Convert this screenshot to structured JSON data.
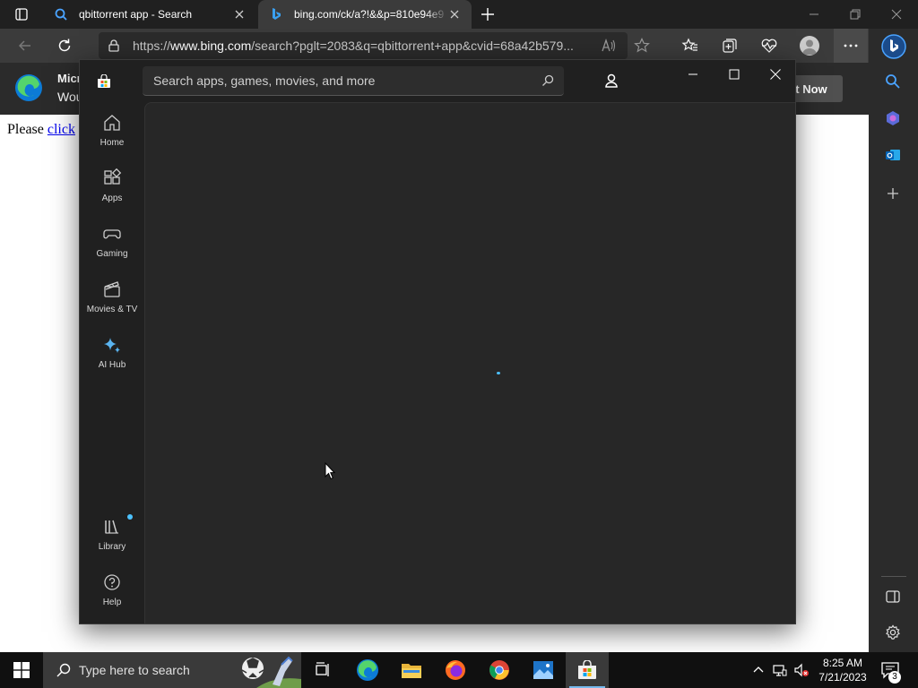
{
  "browser": {
    "tabs": [
      {
        "title": "qbittorrent app - Search"
      },
      {
        "title": "bing.com/ck/a?!&&p=810e94e9"
      }
    ],
    "url": {
      "prefix": "https://",
      "domain": "www.bing.com",
      "path": "/search?pglt=2083&q=qbittorrent+app&cvid=68a42b579..."
    }
  },
  "page": {
    "banner": {
      "title": "Micr",
      "subtitle": "Wou",
      "button": "ot Now"
    },
    "body_text": "Please",
    "link_text": "click"
  },
  "store": {
    "search_placeholder": "Search apps, games, movies, and more",
    "nav": [
      {
        "label": "Home",
        "icon": "home-icon"
      },
      {
        "label": "Apps",
        "icon": "apps-icon"
      },
      {
        "label": "Gaming",
        "icon": "gaming-icon"
      },
      {
        "label": "Movies & TV",
        "icon": "movies-icon"
      },
      {
        "label": "AI Hub",
        "icon": "ai-hub-icon"
      }
    ],
    "footer_nav": [
      {
        "label": "Library",
        "icon": "library-icon"
      },
      {
        "label": "Help",
        "icon": "help-icon"
      }
    ]
  },
  "taskbar": {
    "search_placeholder": "Type here to search",
    "time": "8:25 AM",
    "date": "7/21/2023",
    "notification_count": "3"
  },
  "colors": {
    "accent": "#4cc2ff",
    "store_bg": "#202020",
    "content_bg": "#272727",
    "taskbar_bg": "#101010"
  }
}
